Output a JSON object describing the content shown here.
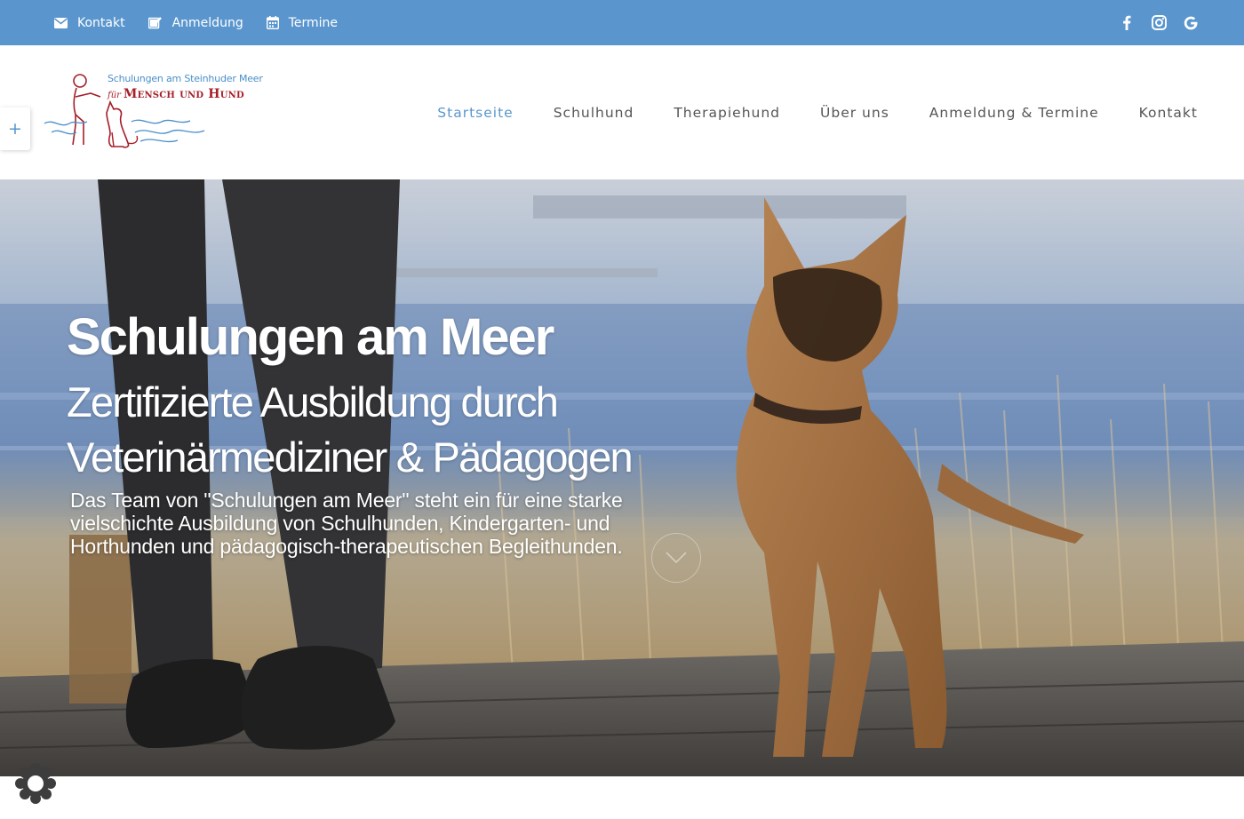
{
  "colors": {
    "topbar": "#5a96cd",
    "logo_blue": "#4a8ec9",
    "logo_red": "#a51e28"
  },
  "topbar": {
    "links": [
      {
        "icon": "envelope-icon",
        "label": "Kontakt"
      },
      {
        "icon": "pencil-square-icon",
        "label": "Anmeldung"
      },
      {
        "icon": "calendar-icon",
        "label": "Termine"
      }
    ],
    "social": [
      "facebook-icon",
      "instagram-icon",
      "google-icon"
    ]
  },
  "logo": {
    "line1": "Schulungen am Steinhuder Meer",
    "fuer": "für",
    "line2": "Mensch und Hund"
  },
  "side_toggle": "+",
  "nav": {
    "items": [
      "Startseite",
      "Schulhund",
      "Therapiehund",
      "Über uns",
      "Anmeldung & Termine",
      "Kontakt"
    ],
    "active": "Startseite"
  },
  "hero": {
    "title": "Schulungen am Meer",
    "subtitle": "Zertifizierte Ausbildung durch Veterinärmediziner & Pädagogen",
    "text": "Das Team von \"Schulungen am Meer\" steht ein für eine starke vielschichte Ausbildung von Schulhunden, Kindergarten- und Horthunden und pädagogisch-therapeutischen Begleithunden."
  }
}
